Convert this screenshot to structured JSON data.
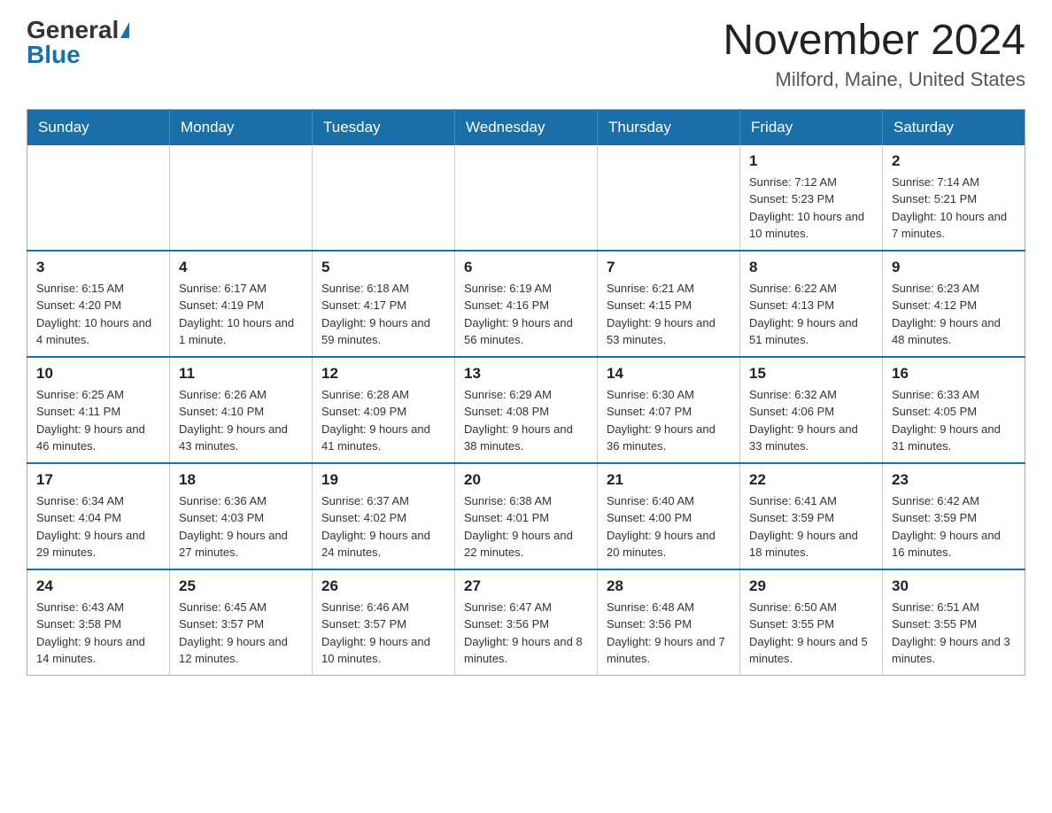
{
  "header": {
    "logo_general": "General",
    "logo_blue": "Blue",
    "month_year": "November 2024",
    "location": "Milford, Maine, United States"
  },
  "weekdays": [
    "Sunday",
    "Monday",
    "Tuesday",
    "Wednesday",
    "Thursday",
    "Friday",
    "Saturday"
  ],
  "weeks": [
    [
      {
        "day": "",
        "info": ""
      },
      {
        "day": "",
        "info": ""
      },
      {
        "day": "",
        "info": ""
      },
      {
        "day": "",
        "info": ""
      },
      {
        "day": "",
        "info": ""
      },
      {
        "day": "1",
        "info": "Sunrise: 7:12 AM\nSunset: 5:23 PM\nDaylight: 10 hours and 10 minutes."
      },
      {
        "day": "2",
        "info": "Sunrise: 7:14 AM\nSunset: 5:21 PM\nDaylight: 10 hours and 7 minutes."
      }
    ],
    [
      {
        "day": "3",
        "info": "Sunrise: 6:15 AM\nSunset: 4:20 PM\nDaylight: 10 hours and 4 minutes."
      },
      {
        "day": "4",
        "info": "Sunrise: 6:17 AM\nSunset: 4:19 PM\nDaylight: 10 hours and 1 minute."
      },
      {
        "day": "5",
        "info": "Sunrise: 6:18 AM\nSunset: 4:17 PM\nDaylight: 9 hours and 59 minutes."
      },
      {
        "day": "6",
        "info": "Sunrise: 6:19 AM\nSunset: 4:16 PM\nDaylight: 9 hours and 56 minutes."
      },
      {
        "day": "7",
        "info": "Sunrise: 6:21 AM\nSunset: 4:15 PM\nDaylight: 9 hours and 53 minutes."
      },
      {
        "day": "8",
        "info": "Sunrise: 6:22 AM\nSunset: 4:13 PM\nDaylight: 9 hours and 51 minutes."
      },
      {
        "day": "9",
        "info": "Sunrise: 6:23 AM\nSunset: 4:12 PM\nDaylight: 9 hours and 48 minutes."
      }
    ],
    [
      {
        "day": "10",
        "info": "Sunrise: 6:25 AM\nSunset: 4:11 PM\nDaylight: 9 hours and 46 minutes."
      },
      {
        "day": "11",
        "info": "Sunrise: 6:26 AM\nSunset: 4:10 PM\nDaylight: 9 hours and 43 minutes."
      },
      {
        "day": "12",
        "info": "Sunrise: 6:28 AM\nSunset: 4:09 PM\nDaylight: 9 hours and 41 minutes."
      },
      {
        "day": "13",
        "info": "Sunrise: 6:29 AM\nSunset: 4:08 PM\nDaylight: 9 hours and 38 minutes."
      },
      {
        "day": "14",
        "info": "Sunrise: 6:30 AM\nSunset: 4:07 PM\nDaylight: 9 hours and 36 minutes."
      },
      {
        "day": "15",
        "info": "Sunrise: 6:32 AM\nSunset: 4:06 PM\nDaylight: 9 hours and 33 minutes."
      },
      {
        "day": "16",
        "info": "Sunrise: 6:33 AM\nSunset: 4:05 PM\nDaylight: 9 hours and 31 minutes."
      }
    ],
    [
      {
        "day": "17",
        "info": "Sunrise: 6:34 AM\nSunset: 4:04 PM\nDaylight: 9 hours and 29 minutes."
      },
      {
        "day": "18",
        "info": "Sunrise: 6:36 AM\nSunset: 4:03 PM\nDaylight: 9 hours and 27 minutes."
      },
      {
        "day": "19",
        "info": "Sunrise: 6:37 AM\nSunset: 4:02 PM\nDaylight: 9 hours and 24 minutes."
      },
      {
        "day": "20",
        "info": "Sunrise: 6:38 AM\nSunset: 4:01 PM\nDaylight: 9 hours and 22 minutes."
      },
      {
        "day": "21",
        "info": "Sunrise: 6:40 AM\nSunset: 4:00 PM\nDaylight: 9 hours and 20 minutes."
      },
      {
        "day": "22",
        "info": "Sunrise: 6:41 AM\nSunset: 3:59 PM\nDaylight: 9 hours and 18 minutes."
      },
      {
        "day": "23",
        "info": "Sunrise: 6:42 AM\nSunset: 3:59 PM\nDaylight: 9 hours and 16 minutes."
      }
    ],
    [
      {
        "day": "24",
        "info": "Sunrise: 6:43 AM\nSunset: 3:58 PM\nDaylight: 9 hours and 14 minutes."
      },
      {
        "day": "25",
        "info": "Sunrise: 6:45 AM\nSunset: 3:57 PM\nDaylight: 9 hours and 12 minutes."
      },
      {
        "day": "26",
        "info": "Sunrise: 6:46 AM\nSunset: 3:57 PM\nDaylight: 9 hours and 10 minutes."
      },
      {
        "day": "27",
        "info": "Sunrise: 6:47 AM\nSunset: 3:56 PM\nDaylight: 9 hours and 8 minutes."
      },
      {
        "day": "28",
        "info": "Sunrise: 6:48 AM\nSunset: 3:56 PM\nDaylight: 9 hours and 7 minutes."
      },
      {
        "day": "29",
        "info": "Sunrise: 6:50 AM\nSunset: 3:55 PM\nDaylight: 9 hours and 5 minutes."
      },
      {
        "day": "30",
        "info": "Sunrise: 6:51 AM\nSunset: 3:55 PM\nDaylight: 9 hours and 3 minutes."
      }
    ]
  ]
}
